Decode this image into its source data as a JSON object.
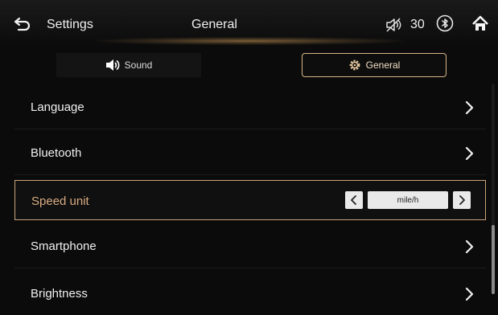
{
  "header": {
    "back_icon": "back-arrow-icon",
    "title_left": "Settings",
    "title_center": "General",
    "mute_icon": "volume-muted-icon",
    "volume_value": "30",
    "bluetooth_icon": "bluetooth-icon",
    "home_icon": "home-icon"
  },
  "tabs": [
    {
      "label": "Sound",
      "icon": "speaker-icon",
      "selected": false
    },
    {
      "label": "General",
      "icon": "gear-icon",
      "selected": true
    }
  ],
  "list": {
    "items": [
      {
        "label": "Language",
        "control": "chevron"
      },
      {
        "label": "Bluetooth",
        "control": "chevron"
      },
      {
        "label": "Speed unit",
        "control": "stepper",
        "value": "mile/h",
        "selected": true
      },
      {
        "label": "Smartphone",
        "control": "chevron"
      },
      {
        "label": "Brightness",
        "control": "chevron"
      }
    ]
  },
  "colors": {
    "accent": "#d9ab82",
    "background": "#0b0b0b",
    "text": "#f0f0f0"
  }
}
